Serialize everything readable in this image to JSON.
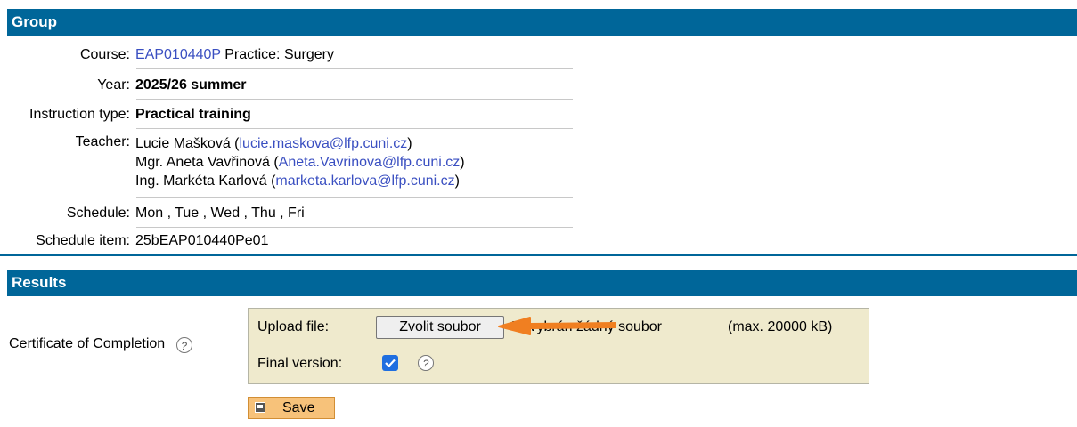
{
  "group": {
    "header": "Group",
    "course_label": "Course:",
    "course_code": "EAP010440P",
    "course_name": "Practice: Surgery",
    "year_label": "Year:",
    "year_value": "2025/26 summer",
    "instruction_label": "Instruction type:",
    "instruction_value": "Practical training",
    "teacher_label": "Teacher:",
    "teachers": [
      {
        "name": "Lucie Mašková",
        "email": "lucie.maskova@lfp.cuni.cz"
      },
      {
        "name": "Mgr. Aneta Vavřinová",
        "email": "Aneta.Vavrinova@lfp.cuni.cz"
      },
      {
        "name": "Ing. Markéta Karlová",
        "email": "marketa.karlova@lfp.cuni.cz"
      }
    ],
    "schedule_label": "Schedule:",
    "schedule_value": "Mon , Tue , Wed , Thu , Fri",
    "schedule_item_label": "Schedule item:",
    "schedule_item_value": "25bEAP010440Pe01"
  },
  "results": {
    "header": "Results",
    "certificate_label": "Certificate of Completion",
    "upload_label": "Upload file:",
    "choose_file_button": "Zvolit soubor",
    "no_file_prefix": "Nevybrán",
    "no_file_suffix": "žádný soubor",
    "max_size": "(max. 20000 kB)",
    "final_version_label": "Final version:",
    "final_version_checked": true,
    "save_label": "Save",
    "help_icon": "?",
    "annotation_arrow_color": "#f07f21"
  }
}
